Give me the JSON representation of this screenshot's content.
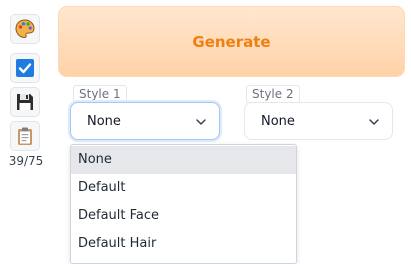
{
  "toolbar": {
    "icons": [
      "palette-icon",
      "checkbox-icon",
      "save-icon",
      "clipboard-icon"
    ],
    "counter": "39/75"
  },
  "generate": {
    "label": "Generate"
  },
  "style1": {
    "label": "Style 1",
    "value": "None"
  },
  "style2": {
    "label": "Style 2",
    "value": "None"
  },
  "dropdown": {
    "options": [
      "None",
      "Default",
      "Default Face",
      "Default Hair"
    ],
    "selected_index": 0
  },
  "colors": {
    "accent": "#f07f11",
    "generate_bg": "#ffdcbb",
    "focus_border": "#a5c8f5",
    "selected_option_bg": "#e5e7eb"
  }
}
